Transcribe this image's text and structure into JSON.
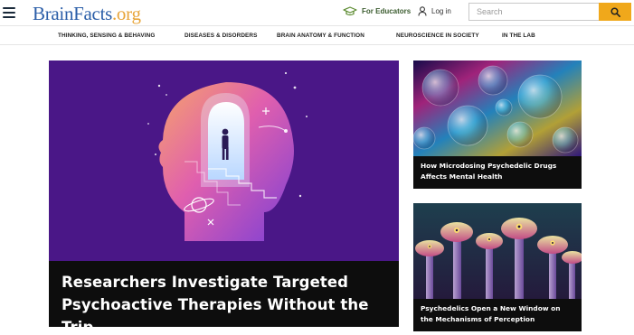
{
  "header": {
    "logo": {
      "brain": "Brain",
      "facts": "Facts",
      "org": ".org"
    },
    "educators_label": "For Educators",
    "login_label": "Log in",
    "search_placeholder": "Search"
  },
  "nav": {
    "items": [
      {
        "label": "THINKING, SENSING & BEHAVING"
      },
      {
        "label": "DISEASES & DISORDERS"
      },
      {
        "label": "BRAIN ANATOMY & FUNCTION"
      },
      {
        "label": "NEUROSCIENCE IN SOCIETY"
      },
      {
        "label": "IN THE LAB"
      }
    ]
  },
  "feature": {
    "title_line1": "Researchers Investigate Targeted",
    "title_line2": "Psychoactive Therapies Without the Trip"
  },
  "cards": [
    {
      "title_line1": "How Microdosing Psychedelic Drugs",
      "title_line2": "Affects Mental Health"
    },
    {
      "title_line1": "Psychedelics Open a New Window on",
      "title_line2": "the Mechanisms of Perception"
    }
  ],
  "colors": {
    "accent": "#f0a81b",
    "brand_blue": "#2b5ea8",
    "feature_bg": "#4a1787",
    "caption_bg": "#0d0d0d"
  }
}
